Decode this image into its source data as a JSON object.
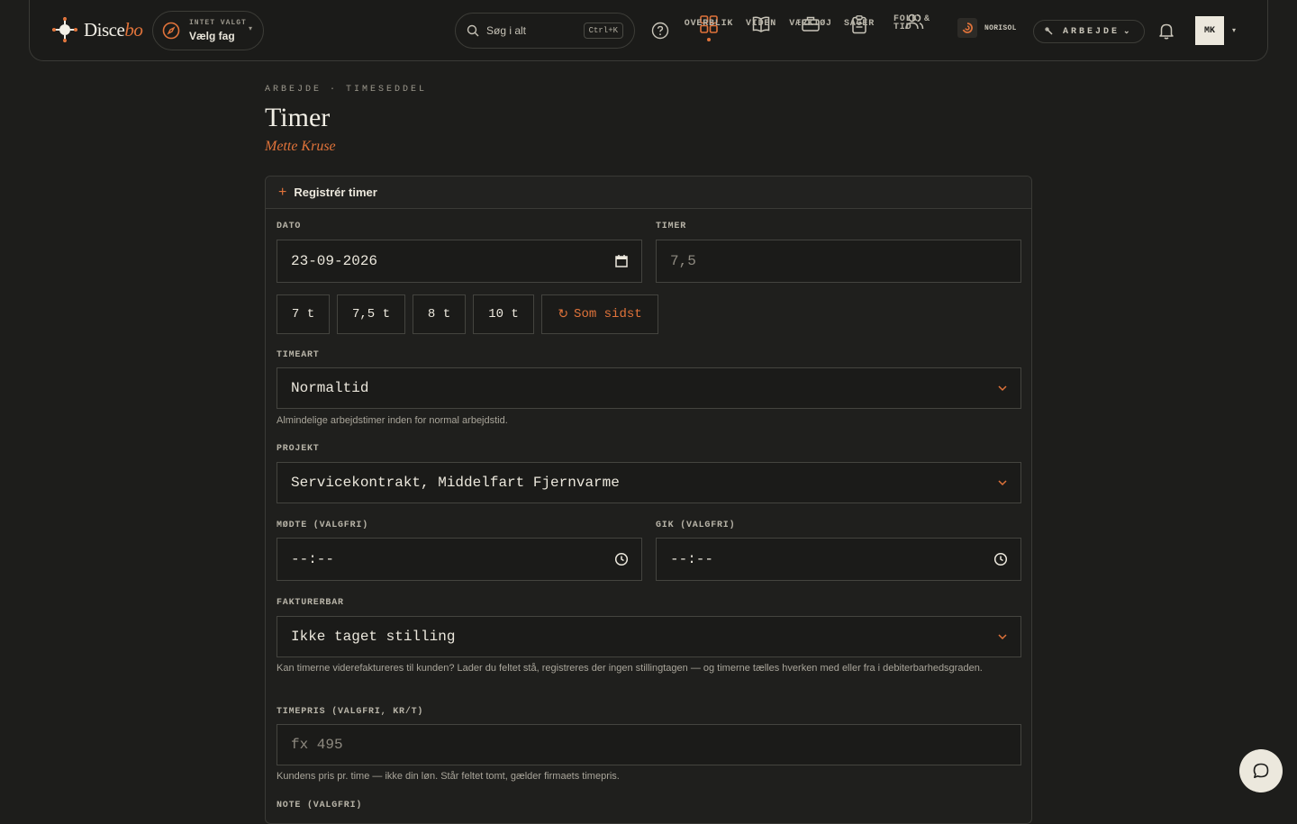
{
  "header": {
    "logo_main": "Disce",
    "logo_accent": "bo",
    "subject_small": "INTET VALGT",
    "subject_label": "Vælg fag",
    "search_placeholder": "Søg i alt",
    "search_shortcut": "Ctrl+K",
    "nav": [
      {
        "label": "OVERBLIK",
        "icon": "grid-icon",
        "active": true
      },
      {
        "label": "VIDEN",
        "icon": "book-icon",
        "active": false
      },
      {
        "label": "VÆRKTØJ",
        "icon": "briefcase-icon",
        "active": false
      },
      {
        "label": "SAGER",
        "icon": "clipboard-icon",
        "active": false
      },
      {
        "label": "FOLK &\nTID",
        "icon": "people-icon",
        "active": false
      }
    ],
    "company": "NORISOL",
    "mode": "ARBEJDE",
    "avatar": "MK"
  },
  "page": {
    "breadcrumb": "ARBEJDE · TIMESEDDEL",
    "title": "Timer",
    "person": "Mette Kruse"
  },
  "form": {
    "heading": "Registrér timer",
    "date_label": "DATO",
    "date_value": "23-09-2026",
    "hours_label": "TIMER",
    "hours_placeholder": "7,5",
    "presets": [
      "7 t",
      "7,5 t",
      "8 t",
      "10 t"
    ],
    "repeat_label": "Som sidst",
    "type_label": "TIMEART",
    "type_value": "Normaltid",
    "type_hint": "Almindelige arbejdstimer inden for normal arbejdstid.",
    "project_label": "PROJEKT",
    "project_value": "Servicekontrakt, Middelfart Fjernvarme",
    "start_label": "MØDTE (VALGFRI)",
    "start_value": "--:--",
    "end_label": "GIK (VALGFRI)",
    "end_value": "--:--",
    "billable_label": "FAKTURERBAR",
    "billable_value": "Ikke taget stilling",
    "billable_hint": "Kan timerne viderefaktureres til kunden? Lader du feltet stå, registreres der ingen stillingtagen — og timerne tælles hverken med eller fra i debiterbarhedsgraden.",
    "rate_label": "TIMEPRIS (VALGFRI, KR/T)",
    "rate_placeholder": "fx 495",
    "rate_hint": "Kundens pris pr. time — ikke din løn. Står feltet tomt, gælder firmaets timepris.",
    "note_label": "NOTE (VALGFRI)"
  },
  "colors": {
    "background": "#1d1d1b",
    "accent": "#e0733a",
    "text": "#ece8dd"
  }
}
